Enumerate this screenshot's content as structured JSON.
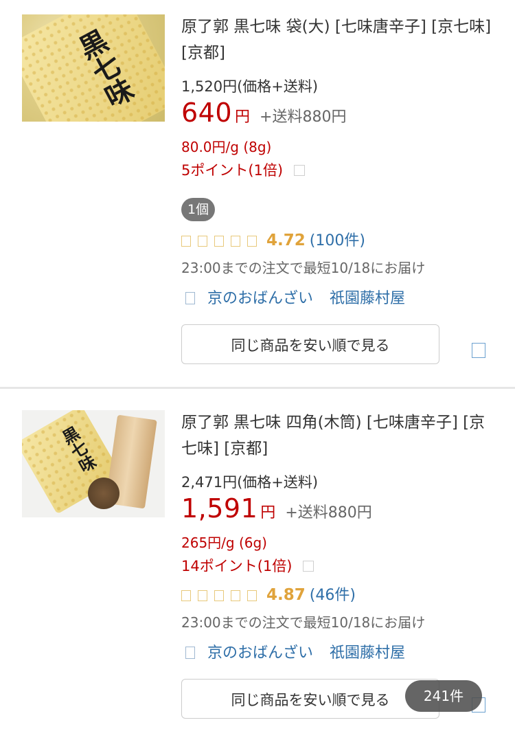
{
  "products": [
    {
      "title": "原了郭 黒七味 袋(大) [七味唐辛子] [京七味] [京都]",
      "image_text": "黒七味",
      "total_price": "1,520円(価格+送料)",
      "price": "640",
      "price_unit": "円",
      "shipping": "+送料880円",
      "unit_price": "80.0円/g (8g)",
      "points": "5ポイント(1倍)",
      "quantity_badge": "1個",
      "rating": "4.72",
      "reviews": "(100件)",
      "delivery": "23:00までの注文で最短10/18にお届け",
      "shop_area": "京のおばんざい",
      "shop_name": "祇園藤村屋",
      "compare_button": "同じ商品を安い順で見る"
    },
    {
      "title": "原了郭 黒七味 四角(木筒) [七味唐辛子] [京七味] [京都]",
      "image_text": "黒七味",
      "total_price": "2,471円(価格+送料)",
      "price": "1,591",
      "price_unit": "円",
      "shipping": "+送料880円",
      "unit_price": "265円/g (6g)",
      "points": "14ポイント(1倍)",
      "rating": "4.87",
      "reviews": "(46件)",
      "delivery": "23:00までの注文で最短10/18にお届け",
      "shop_area": "京のおばんざい",
      "shop_name": "祇園藤村屋",
      "compare_button": "同じ商品を安い順で見る"
    }
  ],
  "result_count": "241件",
  "colors": {
    "price_red": "#bf0000",
    "rating_gold": "#e0a33b",
    "link_blue": "#2f6fa8"
  }
}
